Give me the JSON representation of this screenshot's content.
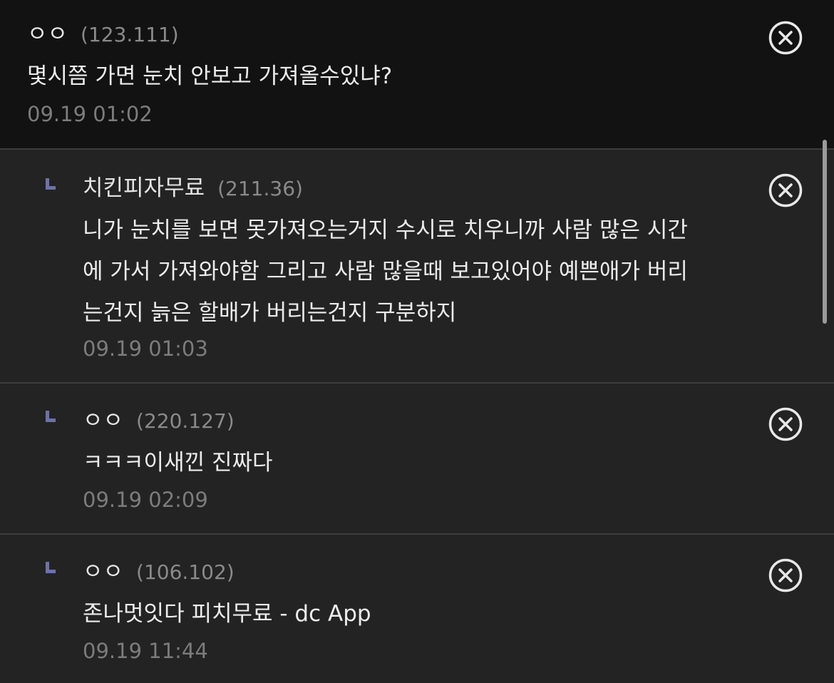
{
  "comments": [
    {
      "nickname": "ㅇㅇ",
      "ip": "(123.111)",
      "lines": [
        "몇시쯤 가면 눈치 안보고 가져올수있냐?"
      ],
      "time": "09.19 01:02"
    },
    {
      "nickname": "치킨피자무료",
      "ip": "(211.36)",
      "lines": [
        "니가 눈치를 보면 못가져오는거지 수시로 치우니까 사람 많은 시간",
        "에 가서 가져와야함 그리고 사람 많을때 보고있어야 예쁜애가 버리",
        "는건지 늙은 할배가 버리는건지 구분하지"
      ],
      "time": "09.19 01:03"
    },
    {
      "nickname": "ㅇㅇ",
      "ip": "(220.127)",
      "lines": [
        "ㅋㅋㅋ이새낀 진짜다"
      ],
      "time": "09.19 02:09"
    },
    {
      "nickname": "ㅇㅇ",
      "ip": "(106.102)",
      "lines": [
        "존나멋잇다 피치무료 - dc App"
      ],
      "time": "09.19 11:44"
    }
  ],
  "icons": {
    "reply": "reply-arrow-icon",
    "delete": "close-circle-icon"
  },
  "colors": {
    "top_background": "#121212",
    "reply_background": "#232323",
    "reply_marker": "#6e72a8",
    "divider": "#3d3d3d"
  }
}
